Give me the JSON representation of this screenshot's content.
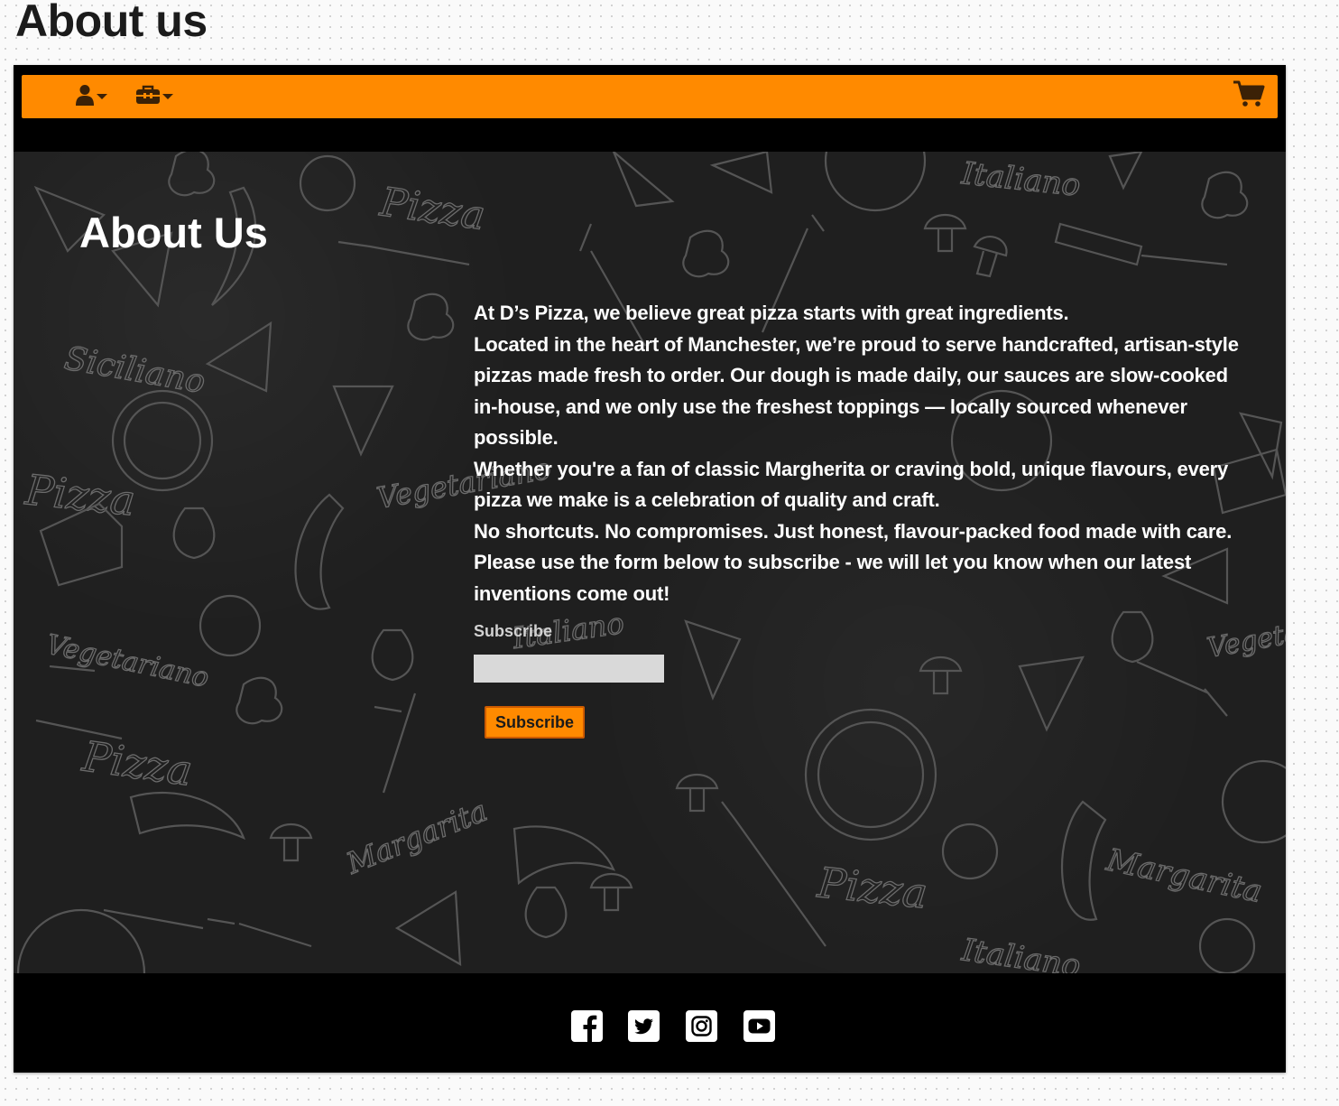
{
  "page": {
    "heading": "About us"
  },
  "navbar": {
    "color": "#ff8a00",
    "items": [
      {
        "icon": "user-icon",
        "has_dropdown": true
      },
      {
        "icon": "toolbox-icon",
        "has_dropdown": true
      }
    ],
    "cart_icon": "shopping-cart-icon"
  },
  "hero": {
    "title": "About Us",
    "paragraphs": [
      "At D’s Pizza, we believe great pizza starts with great ingredients.",
      "Located in the heart of Manchester, we’re proud to serve handcrafted, artisan-style pizzas made fresh to order. Our dough is made daily, our sauces are slow-cooked in-house, and we only use the freshest toppings — locally sourced whenever possible.",
      "Whether you're a fan of classic Margherita or craving bold, unique flavours, every pizza we make is a celebration of quality and craft.",
      "No shortcuts. No compromises. Just honest, flavour-packed food made with care.",
      "Please use the form below to subscribe - we will let you know when our latest inventions come out!"
    ],
    "background_words": [
      "Pizza",
      "Italiano",
      "Siciliano",
      "Vegetariano",
      "Margarita"
    ]
  },
  "subscribe": {
    "label": "Subscribe",
    "input_value": "",
    "input_placeholder": "",
    "button_label": "Subscribe",
    "button_color": "#ff8a00"
  },
  "footer": {
    "social_icons": [
      "facebook-icon",
      "twitter-icon",
      "instagram-icon",
      "youtube-icon"
    ]
  }
}
